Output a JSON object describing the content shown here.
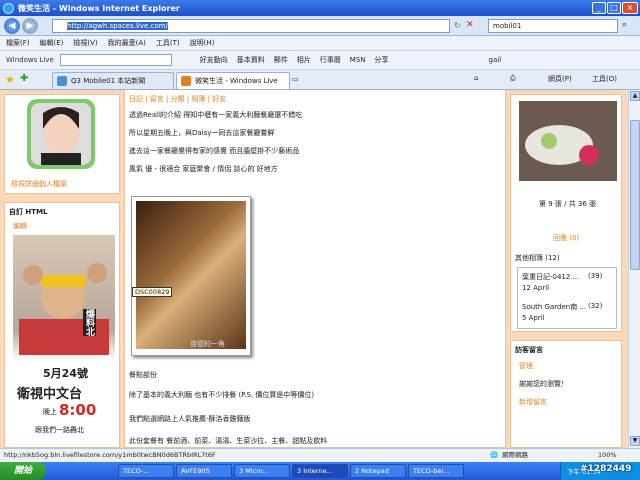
{
  "window": {
    "title": "微笑生活 - Windows Internet Explorer",
    "min": "_",
    "max": "□",
    "close": "×"
  },
  "address": {
    "url": "http://agwh.spaces.live.com/",
    "search_value": "mobil01"
  },
  "menu": [
    "檔案(F)",
    "編輯(E)",
    "檢視(V)",
    "我的最愛(A)",
    "工具(T)",
    "說明(H)"
  ],
  "wlbar": {
    "logo": "Windows Live",
    "items": [
      "好友動向",
      "基本資料",
      "郵件",
      "相片",
      "行事曆",
      "MSN",
      "分享"
    ],
    "user": "gail"
  },
  "tabs": [
    {
      "label": "Q3 Mobile01 本站新聞"
    },
    {
      "label": "微笑生活 - Windows Live"
    }
  ],
  "commands": {
    "page": "網頁(P)",
    "tools": "工具(O)"
  },
  "sidebar": {
    "profile_link": "檢視詳細個人檔案",
    "custom_title": "自訂 HTML",
    "edit": "編輯",
    "ad": {
      "date": "5月24號",
      "channel": "衛視中文台",
      "time_label": "晚上",
      "time": "8:00",
      "tagline": "跟我們一路轟北",
      "show": "爆料北"
    }
  },
  "post": {
    "header": "日記 | 留言 | 分類 | 相簿 | 好友",
    "lines": [
      "透過Reall的介紹 得知中壢有一家義大利麵餐廳還不錯吃",
      "所以星期五晚上，與Daisy一同去這家餐廳嘗鮮",
      "進去這一家餐廳覺得有家的感覺 而且牆壁掛不少藝術品",
      "風氣 優 - 很適合 家庭聚會 / 情侶 談心的 好地方"
    ],
    "photo_label": "DSC00829",
    "photo_watermark": "食德的一角",
    "lower": [
      "餐點部份",
      "除了基本的義大利麵 也有不少排餐 (P.S. 價位算是中等價位)",
      "我們點選網路上人氣推薦-酥洛香雞麵飯",
      "此份套餐有 餐前酒、前菜、湯湯、生菜沙拉、主餐、甜點及飲料"
    ]
  },
  "rightbar": {
    "pager": "第 9 張 / 共 36 張",
    "playlink": "回應 (0)",
    "related_title": "其他相簿 (12)",
    "albums": [
      {
        "name": "葉重日記-0412 ...",
        "count": "(39)",
        "date": "12 April"
      },
      {
        "name": "South Garden南 ...",
        "count": "(32)",
        "date": "5 April"
      }
    ],
    "guest_title": "訪客留言",
    "guest_manage": "管理",
    "guest_text": "謝謝您的瀏覽！",
    "guest_link": "新增留言"
  },
  "status": {
    "url": "http://nkb5og.bln.livefilestore.com/y1mb0twcBN0d6BTRbIRL7t6F",
    "zone": "網際網路",
    "zoom": "100%"
  },
  "taskbar": {
    "start": "開始",
    "items": [
      "TECO-...",
      "AVFE905",
      "3 Micro...",
      "3 Interne...",
      "2 Notepad",
      "TECO-bei..."
    ],
    "clock": "下午 01:34",
    "stamp": "#1282449"
  },
  "colors": {
    "accent": "#e08020",
    "page_bg": "#fbd8b7",
    "ie_blue": "#1d4fc9"
  }
}
